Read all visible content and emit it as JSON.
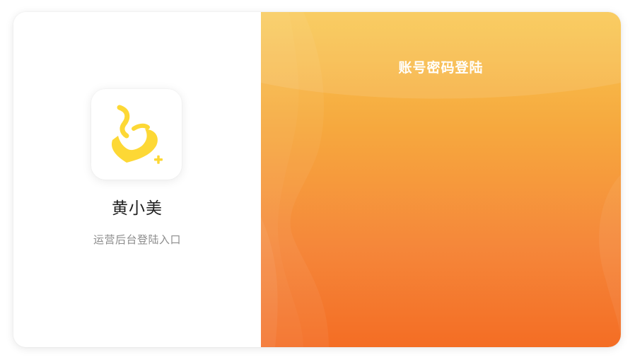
{
  "brand": {
    "logo_icon": "yellow-heart-person-plus-logo",
    "name": "黄小美",
    "subtitle": "运营后台登陆入口"
  },
  "login_panel": {
    "title": "账号密码登陆"
  },
  "colors": {
    "brand_yellow": "#fdd835",
    "gradient_top": "#f9c852",
    "gradient_bottom": "#f46d24",
    "name_text": "#1f1f1f",
    "subtitle_text": "#8c8c8c"
  }
}
